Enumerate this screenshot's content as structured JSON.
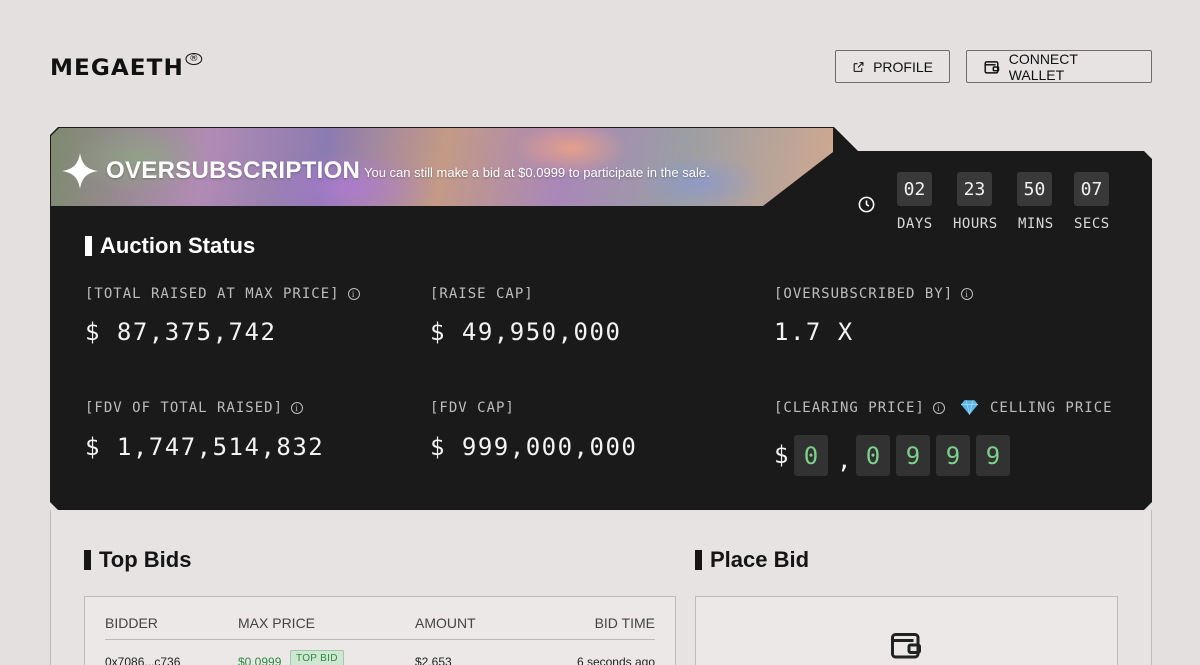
{
  "header": {
    "logo": "MEGAETH",
    "logo_mark": "®",
    "profile_label": "PROFILE",
    "profile_icon": "external-link-icon",
    "wallet_label": "CONNECT WALLET",
    "wallet_icon": "wallet-icon"
  },
  "banner": {
    "title": "OVERSUBSCRIPTION",
    "subtitle": "You can still make a bid at $0.0999 to participate in the sale.",
    "icon": "sparkle-icon"
  },
  "countdown": {
    "icon": "clock-icon",
    "days": "02",
    "days_label": "DAYS",
    "hours": "23",
    "hours_label": "HOURS",
    "mins": "50",
    "mins_label": "MINS",
    "secs": "07",
    "secs_label": "SECS"
  },
  "auction": {
    "title": "Auction Status",
    "total_raised_label": "[TOTAL RAISED AT MAX PRICE]",
    "total_raised_value": "$ 87,375,742",
    "raise_cap_label": "[RAISE CAP]",
    "raise_cap_value": "$ 49,950,000",
    "oversubscribed_label": "[OVERSUBSCRIBED BY]",
    "oversubscribed_value": "1.7 X",
    "fdv_total_label": "[FDV OF TOTAL RAISED]",
    "fdv_total_value": "$ 1,747,514,832",
    "fdv_cap_label": "[FDV CAP]",
    "fdv_cap_value": "$ 999,000,000",
    "clearing_label": "[CLEARING PRICE]",
    "ceiling_label": "CELLING PRICE",
    "clearing_dollar": "$",
    "clearing_digits": [
      "0",
      "0",
      "9",
      "9",
      "9"
    ],
    "clearing_sep": ",",
    "accent_color": "#7cd18b"
  },
  "top_bids": {
    "title": "Top Bids",
    "columns": [
      "BIDDER",
      "MAX PRICE",
      "AMOUNT",
      "BID TIME"
    ],
    "rows": [
      {
        "bidder": "0x7086...c736",
        "max_price": "$0.0999",
        "badge": "TOP BID",
        "amount": "$2,653",
        "bid_time": "6 seconds ago"
      }
    ]
  },
  "place_bid": {
    "title": "Place Bid",
    "icon": "wallet-icon"
  }
}
